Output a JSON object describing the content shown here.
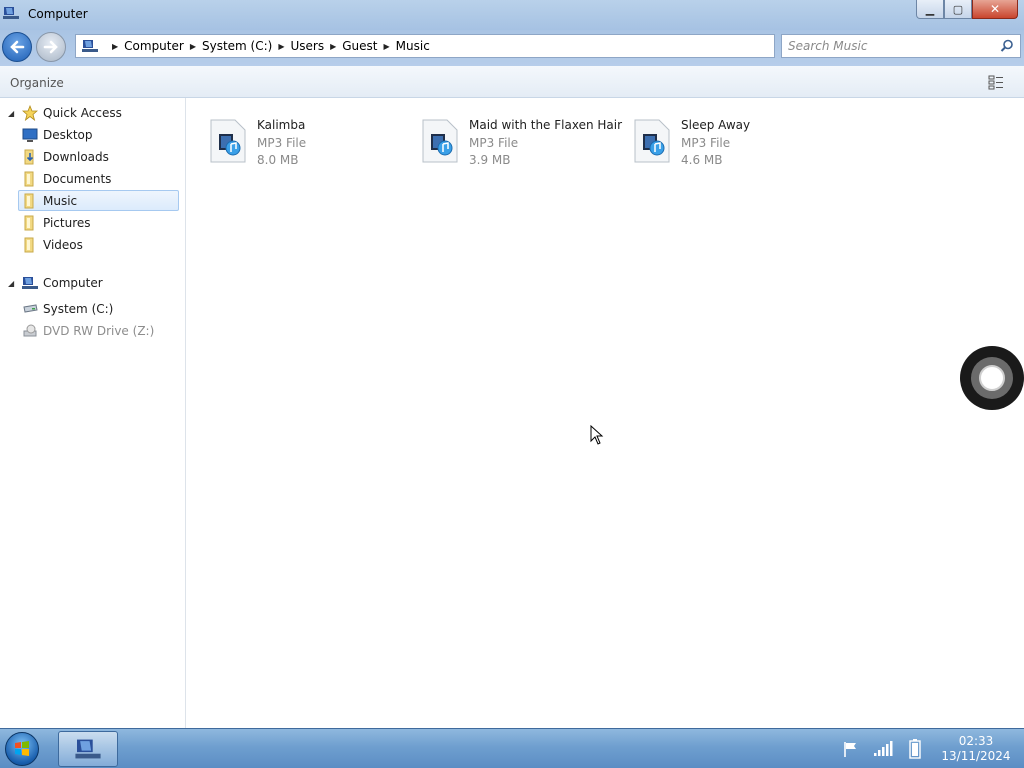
{
  "window": {
    "title": "Computer"
  },
  "address": {
    "crumbs": [
      "Computer",
      "System (C:)",
      "Users",
      "Guest",
      "Music"
    ]
  },
  "search": {
    "placeholder": "Search Music"
  },
  "toolbar": {
    "organize_label": "Organize"
  },
  "sidebar": {
    "quick_access": {
      "label": "Quick Access",
      "items": [
        {
          "label": "Desktop",
          "icon": "desktop-icon"
        },
        {
          "label": "Downloads",
          "icon": "folder-icon"
        },
        {
          "label": "Documents",
          "icon": "folder-icon"
        },
        {
          "label": "Music",
          "icon": "folder-icon",
          "selected": true
        },
        {
          "label": "Pictures",
          "icon": "folder-icon"
        },
        {
          "label": "Videos",
          "icon": "folder-icon"
        }
      ]
    },
    "computer": {
      "label": "Computer",
      "items": [
        {
          "label": "System (C:)",
          "icon": "drive-icon"
        },
        {
          "label": "DVD RW Drive (Z:)",
          "icon": "dvd-drive-icon",
          "disabled": true
        }
      ]
    }
  },
  "files": [
    {
      "name": "Kalimba",
      "type": "MP3 File",
      "size": "8.0 MB"
    },
    {
      "name": "Maid with the Flaxen Hair",
      "type": "MP3 File",
      "size": "3.9 MB"
    },
    {
      "name": "Sleep Away",
      "type": "MP3 File",
      "size": "4.6 MB"
    }
  ],
  "taskbar": {
    "time": "02:33",
    "date": "13/11/2024"
  },
  "colors": {
    "titlebar": "#b9d1ea",
    "taskbar": "#6f9fcf",
    "selection_border": "#a6c9f0"
  }
}
